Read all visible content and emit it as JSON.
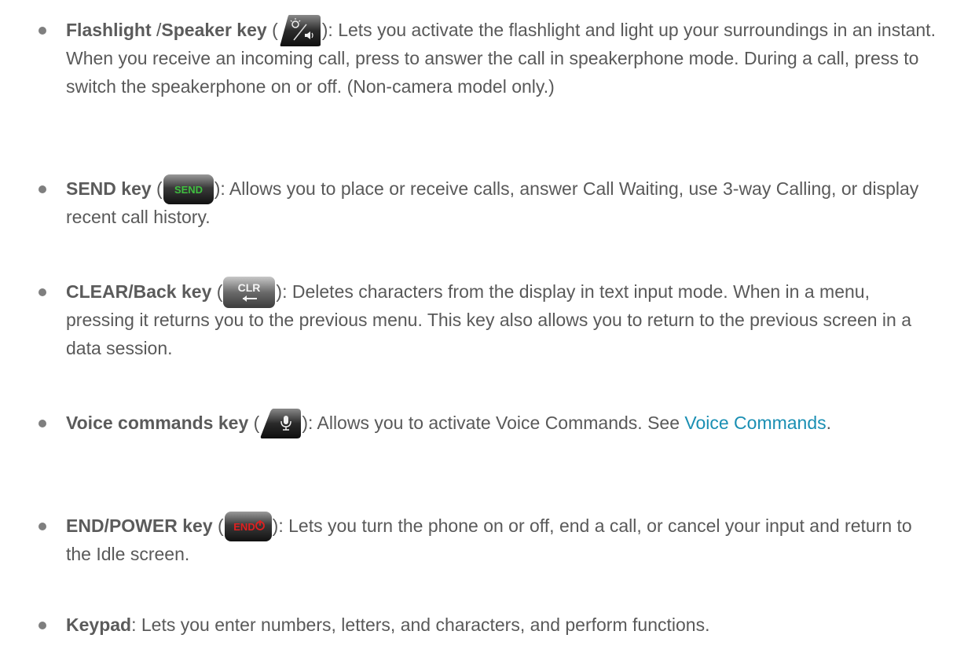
{
  "items": [
    {
      "title_part1": "Flashlight",
      "sep": " /",
      "title_part2": "Speaker key",
      "paren_open": " (",
      "paren_close": ")",
      "description": ": Lets you activate the flashlight and light up your surroundings in an instant. When you receive an incoming call, press to answer the call in speakerphone mode. During a call, press to switch the speakerphone on or off. (Non-camera model only.)",
      "icon": "flashlight-speaker-key-icon"
    },
    {
      "title": "SEND key",
      "paren_open": " (",
      "paren_close": ")",
      "key_label": "SEND",
      "description": ": Allows you to place or receive calls, answer Call Waiting, use 3-way Calling, or display recent call history.",
      "icon": "send-key-icon"
    },
    {
      "title": "CLEAR/Back key",
      "paren_open": " (",
      "paren_close": ")",
      "key_label": "CLR",
      "description": ": Deletes characters from the display in text input mode. When in a menu, pressing it returns you to the previous menu. This key also allows you to return to the previous screen in a data session.",
      "icon": "clear-back-key-icon"
    },
    {
      "title": "Voice commands key",
      "paren_open": " (",
      "paren_close": ")",
      "description_pre": ": Allows you to activate Voice Commands. See ",
      "link_text": "Voice Commands",
      "description_post": ".",
      "icon": "voice-commands-key-icon"
    },
    {
      "title": "END/POWER key",
      "paren_open": " (",
      "paren_close": ")",
      "key_label": "END",
      "description": ": Lets you turn the phone on or off, end a call, or cancel your input and return to the Idle screen.",
      "icon": "end-power-key-icon"
    },
    {
      "title": "Keypad",
      "description": ": Lets you enter numbers, letters, and characters, and perform functions."
    }
  ],
  "colors": {
    "text": "#595959",
    "link": "#1a8fb3",
    "send_green": "#3fbf3f",
    "end_red": "#e02020"
  }
}
